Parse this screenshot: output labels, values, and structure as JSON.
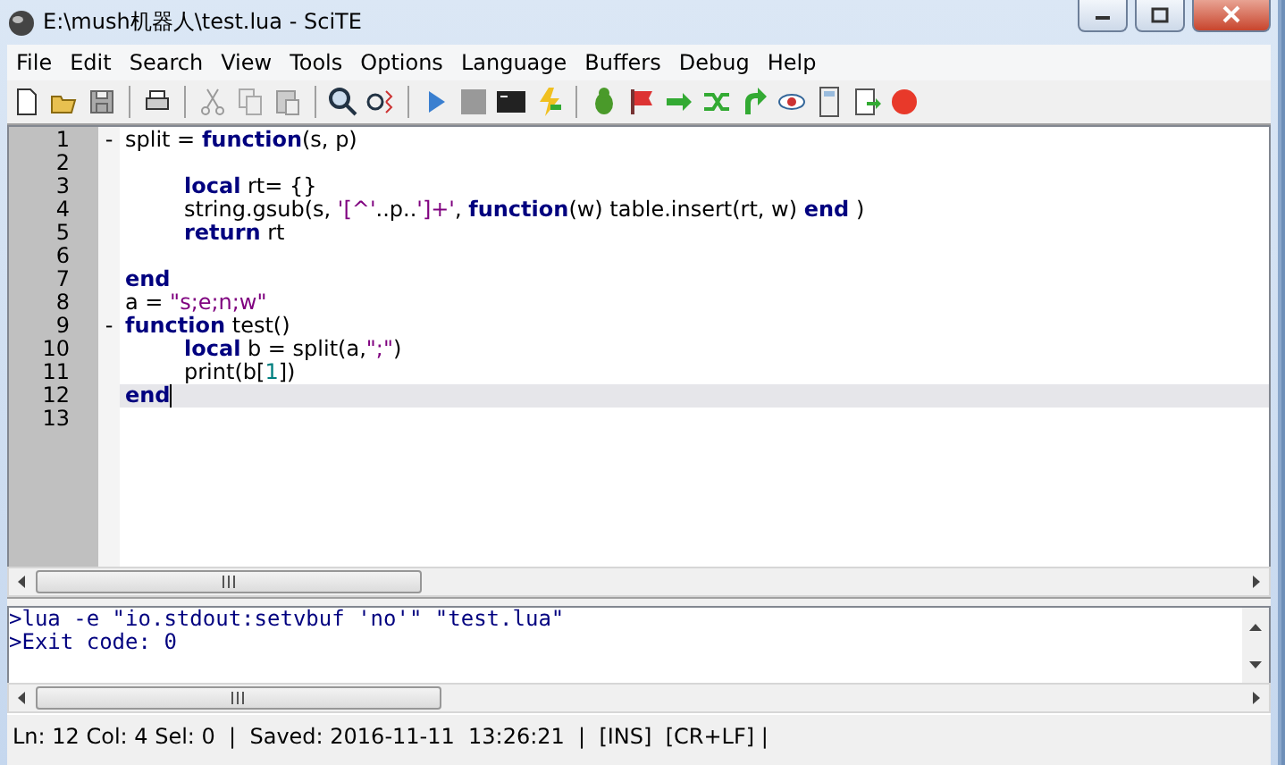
{
  "window": {
    "title": "E:\\mush机器人\\test.lua - SciTE"
  },
  "menu": [
    "File",
    "Edit",
    "Search",
    "View",
    "Tools",
    "Options",
    "Language",
    "Buffers",
    "Debug",
    "Help"
  ],
  "editor": {
    "lines": [
      {
        "number": "1",
        "fold": "-",
        "current": false,
        "tokens": [
          {
            "kind": "plain",
            "text": "split = "
          },
          {
            "kind": "keyword",
            "text": "function"
          },
          {
            "kind": "plain",
            "text": "(s, p)"
          }
        ],
        "children": [
          {
            "number": "2"
          },
          {
            "number": "3",
            "current": false,
            "tokens": [
              {
                "kind": "keyword",
                "text": "local"
              },
              {
                "kind": "plain",
                "text": " rt= {}"
              }
            ]
          },
          {
            "number": "4",
            "current": false,
            "tokens": [
              {
                "kind": "plain",
                "text": "string.gsub(s, "
              },
              {
                "kind": "string",
                "text": "'[^'"
              },
              {
                "kind": "plain",
                "text": "..p.."
              },
              {
                "kind": "string",
                "text": "']+'"
              },
              {
                "kind": "plain",
                "text": ", "
              },
              {
                "kind": "keyword",
                "text": "function"
              },
              {
                "kind": "plain",
                "text": "(w) table.insert(rt, w) "
              },
              {
                "kind": "keyword",
                "text": "end"
              },
              {
                "kind": "plain",
                "text": " )"
              }
            ]
          },
          {
            "number": "5",
            "current": false,
            "tokens": [
              {
                "kind": "keyword",
                "text": "return"
              },
              {
                "kind": "plain",
                "text": " rt"
              }
            ]
          },
          {
            "number": "6"
          }
        ]
      },
      {
        "number": "7",
        "current": false,
        "tokens": [
          {
            "kind": "keyword",
            "text": "end"
          }
        ]
      },
      {
        "number": "8",
        "current": false,
        "tokens": [
          {
            "kind": "plain",
            "text": "a = "
          },
          {
            "kind": "string",
            "text": "\"s;e;n;w\""
          }
        ]
      },
      {
        "number": "9",
        "fold": "-",
        "current": false,
        "tokens": [
          {
            "kind": "keyword",
            "text": "function"
          },
          {
            "kind": "plain",
            "text": " test()"
          }
        ],
        "children": [
          {
            "number": "10",
            "current": false,
            "tokens": [
              {
                "kind": "keyword",
                "text": "local"
              },
              {
                "kind": "plain",
                "text": " b = split(a,"
              },
              {
                "kind": "string",
                "text": "\";\""
              },
              {
                "kind": "plain",
                "text": ")"
              }
            ]
          },
          {
            "number": "11",
            "current": false,
            "tokens": [
              {
                "kind": "plain",
                "text": "print(b["
              },
              {
                "kind": "number",
                "text": "1"
              },
              {
                "kind": "plain",
                "text": "])"
              }
            ]
          }
        ]
      },
      {
        "number": "12",
        "current": true,
        "tokens": [
          {
            "kind": "keyword",
            "text": "end"
          }
        ]
      },
      {
        "number": "13"
      }
    ]
  },
  "output": {
    "lines": [
      ">lua -e \"io.stdout:setvbuf 'no'\" \"test.lua\"",
      ">Exit code: 0"
    ]
  },
  "status_bar": {
    "text": "Ln: 12 Col: 4 Sel: 0  |  Saved: 2016-11-11  13:26:21  |  [INS]  [CR+LF] |"
  }
}
